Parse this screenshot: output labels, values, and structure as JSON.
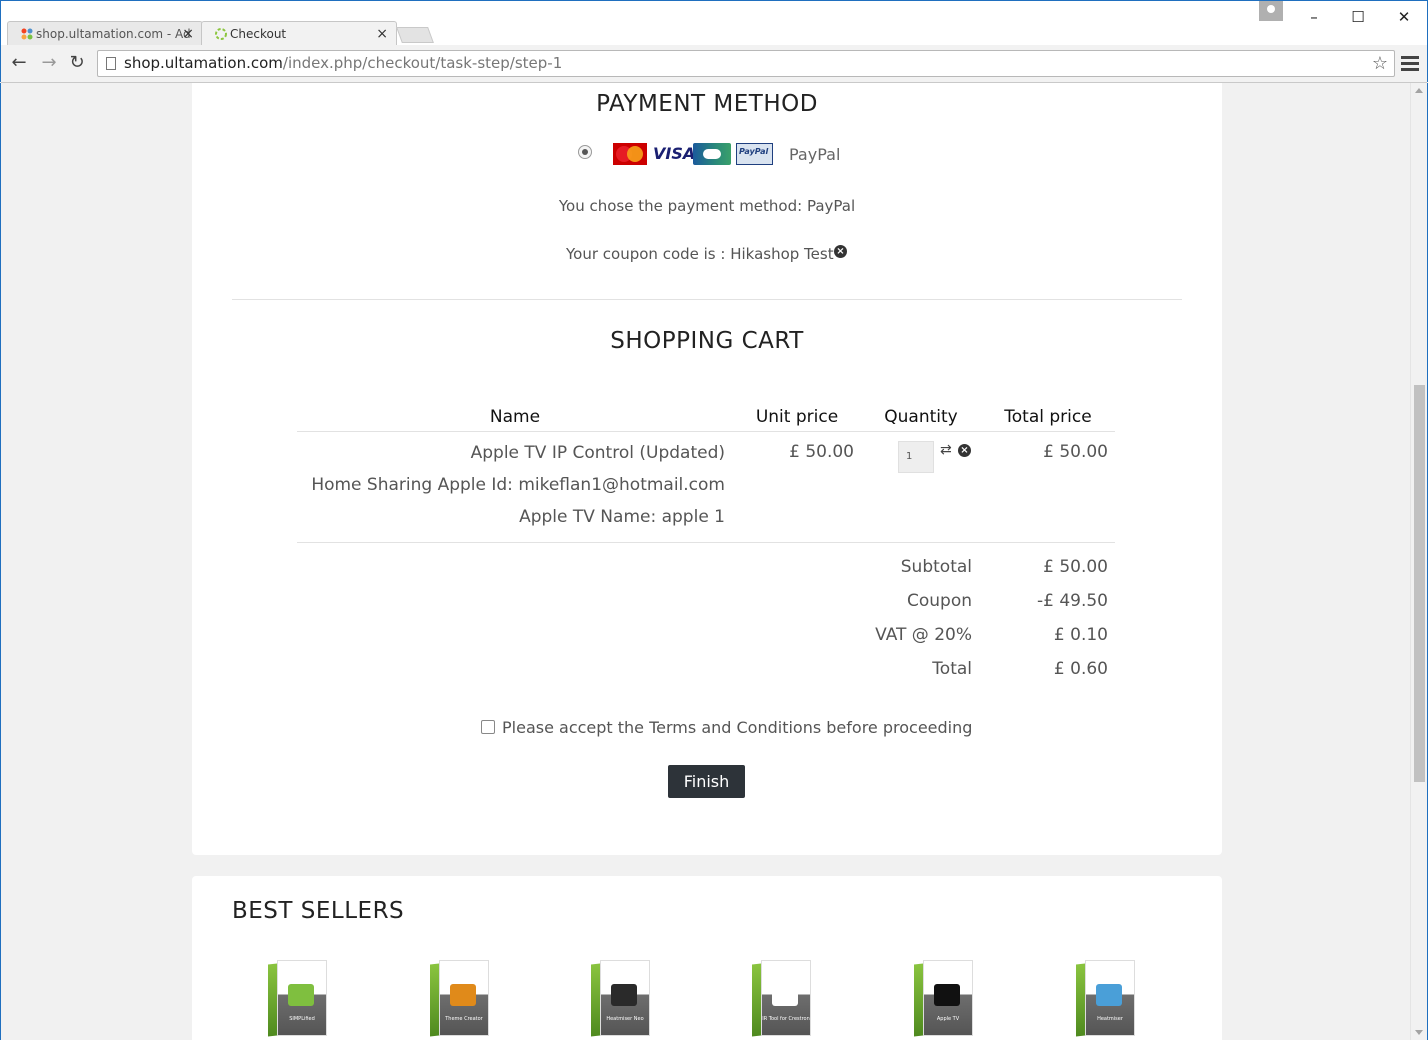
{
  "browser": {
    "tabs": [
      {
        "title": "shop.ultamation.com - Ad",
        "active": false,
        "favicon": "joomla-icon"
      },
      {
        "title": "Checkout",
        "active": true,
        "favicon": "loading-spinner-icon"
      }
    ],
    "url_host": "shop.ultamation.com",
    "url_path": "/index.php/checkout/task-step/step-1"
  },
  "payment": {
    "title": "PAYMENT METHOD",
    "cards": [
      "mastercard-icon",
      "visa-icon",
      "cb-icon",
      "paypal-icon"
    ],
    "method_label": "PayPal",
    "chosen_text": "You chose the payment method: PayPal",
    "coupon_text": "Your coupon code is : Hikashop Test"
  },
  "cart": {
    "title": "SHOPPING CART",
    "headers": {
      "name": "Name",
      "unit_price": "Unit price",
      "quantity": "Quantity",
      "total_price": "Total price"
    },
    "item": {
      "name": "Apple TV IP Control (Updated)",
      "option1": "Home Sharing Apple Id: mikeflan1@hotmail.com",
      "option2": "Apple TV Name: apple 1",
      "unit_price": "£ 50.00",
      "quantity": "1",
      "total_price": "£ 50.00"
    },
    "totals": [
      {
        "label": "Subtotal",
        "value": "£ 50.00"
      },
      {
        "label": "Coupon",
        "value": "-£ 49.50"
      },
      {
        "label": "VAT @ 20%",
        "value": "£ 0.10"
      },
      {
        "label": "Total",
        "value": "£ 0.60"
      }
    ],
    "terms_label": "Please accept the Terms and Conditions before proceeding",
    "finish_label": "Finish"
  },
  "bestsellers": {
    "title": "BEST SELLERS",
    "products": [
      {
        "label": "SIMPLified",
        "art_color": "#7fbf3f"
      },
      {
        "label": "Theme Creator",
        "art_color": "#e08a1a"
      },
      {
        "label": "Heatmiser Neo",
        "art_color": "#2a2a2a"
      },
      {
        "label": "IR Tool for Crestron",
        "art_color": "#ffffff"
      },
      {
        "label": "Apple TV",
        "art_color": "#111111"
      },
      {
        "label": "Heatmiser",
        "art_color": "#4a9fd8"
      }
    ]
  }
}
